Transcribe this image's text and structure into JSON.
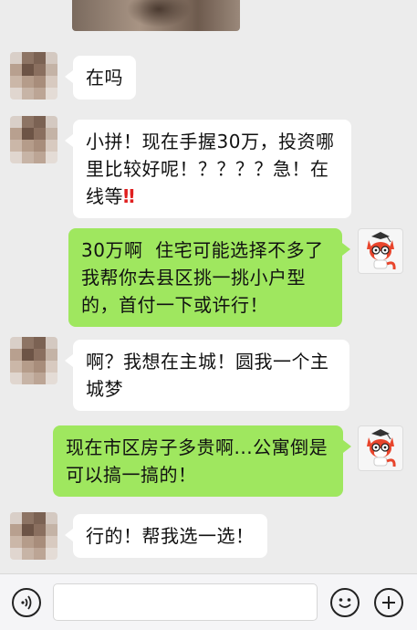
{
  "messages": [
    {
      "from": "other",
      "text": "在吗"
    },
    {
      "from": "other",
      "text": "小拼！现在手握30万，投资哪\n里比较好呢！？？？？急！在\n线等",
      "suffix": "‼"
    },
    {
      "from": "me",
      "text": "30万啊  住宅可能选择不多了\n我帮你去县区挑一挑小户型\n的，首付一下或许行！"
    },
    {
      "from": "other",
      "text": "啊？我想在主城！圆我一个主\n城梦"
    },
    {
      "from": "me",
      "text": "现在市区房子多贵啊...公寓倒是\n可以搞一搞的！"
    },
    {
      "from": "other",
      "text": "行的！帮我选一选！"
    }
  ],
  "colors": {
    "chat_background": "#ececec",
    "incoming_bubble": "#ffffff",
    "outgoing_bubble": "#9fe75f",
    "exclamation": "#e02020"
  },
  "icons": {
    "voice": "voice-input-icon",
    "emoji": "emoji-icon",
    "more": "plus-icon"
  }
}
